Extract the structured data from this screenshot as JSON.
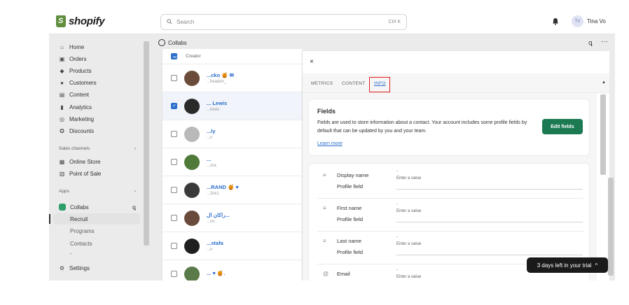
{
  "topbar": {
    "brand": "shopify",
    "search_placeholder": "Search",
    "search_shortcut": "Ctrl K",
    "avatar_initials": "TV",
    "user_name": "Tina Vo"
  },
  "sidebar": {
    "items": [
      {
        "icon": "home-icon",
        "glyph": "⌂",
        "label": "Home"
      },
      {
        "icon": "orders-icon",
        "glyph": "▣",
        "label": "Orders"
      },
      {
        "icon": "tag-icon",
        "glyph": "◆",
        "label": "Products"
      },
      {
        "icon": "person-icon",
        "glyph": "●",
        "label": "Customers"
      },
      {
        "icon": "content-icon",
        "glyph": "▤",
        "label": "Content"
      },
      {
        "icon": "analytics-icon",
        "glyph": "▮",
        "label": "Analytics"
      },
      {
        "icon": "marketing-icon",
        "glyph": "◎",
        "label": "Marketing"
      },
      {
        "icon": "discount-icon",
        "glyph": "✪",
        "label": "Discounts"
      }
    ],
    "sales_channels_label": "Sales channels",
    "channels": [
      {
        "icon": "store-icon",
        "glyph": "▦",
        "label": "Online Store"
      },
      {
        "icon": "pos-icon",
        "glyph": "▥",
        "label": "Point of Sale"
      }
    ],
    "apps_label": "Apps",
    "app_name": "Collabs",
    "app_subitems": [
      "Recruit",
      "Programs",
      "Contacts",
      "-"
    ],
    "settings_label": "Settings",
    "chevron": "›"
  },
  "main": {
    "app_title": "Collabs",
    "list_header": "Creator",
    "rows": [
      {
        "name": "...cko 🍯 ✉",
        "handle": "...headen_",
        "selected": false,
        "color": "#6b4c3b"
      },
      {
        "name": "... Lewis",
        "handle": "...lewis",
        "selected": true,
        "color": "#2a2a2a"
      },
      {
        "name": "...ly",
        "handle": "...n",
        "selected": false,
        "color": "#b9b9b9"
      },
      {
        "name": "...",
        "handle": "...ora",
        "selected": false,
        "color": "#4f7a3a"
      },
      {
        "name": "...RAND 🍯 ♥",
        "handle": "...3sk1",
        "selected": false,
        "color": "#3a3a3a"
      },
      {
        "name": "راكان ال...",
        "handle": "...on",
        "selected": false,
        "color": "#6a4a3a"
      },
      {
        "name": "...stafa",
        "handle": "...n",
        "selected": false,
        "color": "#1f1f1f"
      },
      {
        "name": "... ♥ 🍯.",
        "handle": "",
        "selected": false,
        "color": "#5a7a4a"
      }
    ]
  },
  "drawer": {
    "close": "×",
    "tabs": [
      "METRICS",
      "CONTENT",
      "INFO"
    ],
    "fields_title": "Fields",
    "fields_desc": "Fields are used to store information about a contact. Your account includes some profile fields by default that can be updated by you and your team.",
    "learn_more": "Learn more",
    "edit_fields": "Edit fields",
    "field_rows": [
      {
        "icon": "text-lines-icon",
        "glyph": "≡",
        "name": "Display name",
        "type": "Profile field",
        "dash": "-",
        "placeholder": "Enter a value"
      },
      {
        "icon": "text-lines-icon",
        "glyph": "≡",
        "name": "First name",
        "type": "Profile field",
        "dash": "-",
        "placeholder": "Enter a value"
      },
      {
        "icon": "text-lines-icon",
        "glyph": "≡",
        "name": "Last name",
        "type": "Profile field",
        "dash": "-",
        "placeholder": "Enter a value"
      },
      {
        "icon": "at-icon",
        "glyph": "@",
        "name": "Email",
        "type": "",
        "dash": "-",
        "placeholder": "Enter a value"
      }
    ]
  },
  "trial_banner": "3 days left in your trial",
  "trial_caret": "^"
}
